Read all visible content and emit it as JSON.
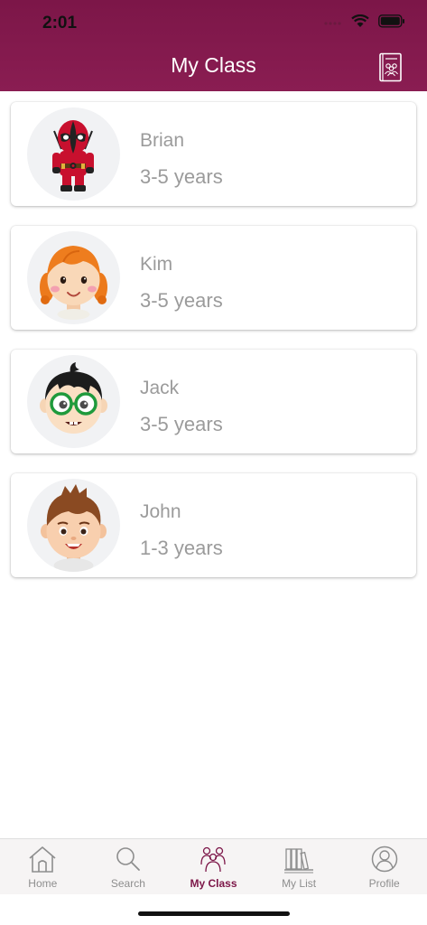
{
  "status": {
    "time": "2:01"
  },
  "header": {
    "title": "My Class",
    "action_icon": "class-book-icon"
  },
  "children": [
    {
      "name": "Brian",
      "age": "3-5 years",
      "avatar": "deadpool-avatar"
    },
    {
      "name": "Kim",
      "age": "3-5 years",
      "avatar": "redhead-girl-avatar"
    },
    {
      "name": "Jack",
      "age": "3-5 years",
      "avatar": "glasses-boy-avatar"
    },
    {
      "name": "John",
      "age": "1-3 years",
      "avatar": "brown-hair-boy-avatar"
    }
  ],
  "tabs": [
    {
      "label": "Home",
      "icon": "home-icon"
    },
    {
      "label": "Search",
      "icon": "search-icon"
    },
    {
      "label": "My Class",
      "icon": "my-class-icon",
      "active": true
    },
    {
      "label": "My List",
      "icon": "books-icon"
    },
    {
      "label": "Profile",
      "icon": "profile-icon"
    }
  ],
  "colors": {
    "brand": "#7c1648",
    "text_muted": "#9b9b9b",
    "tab_inactive": "#8e8e8e"
  }
}
